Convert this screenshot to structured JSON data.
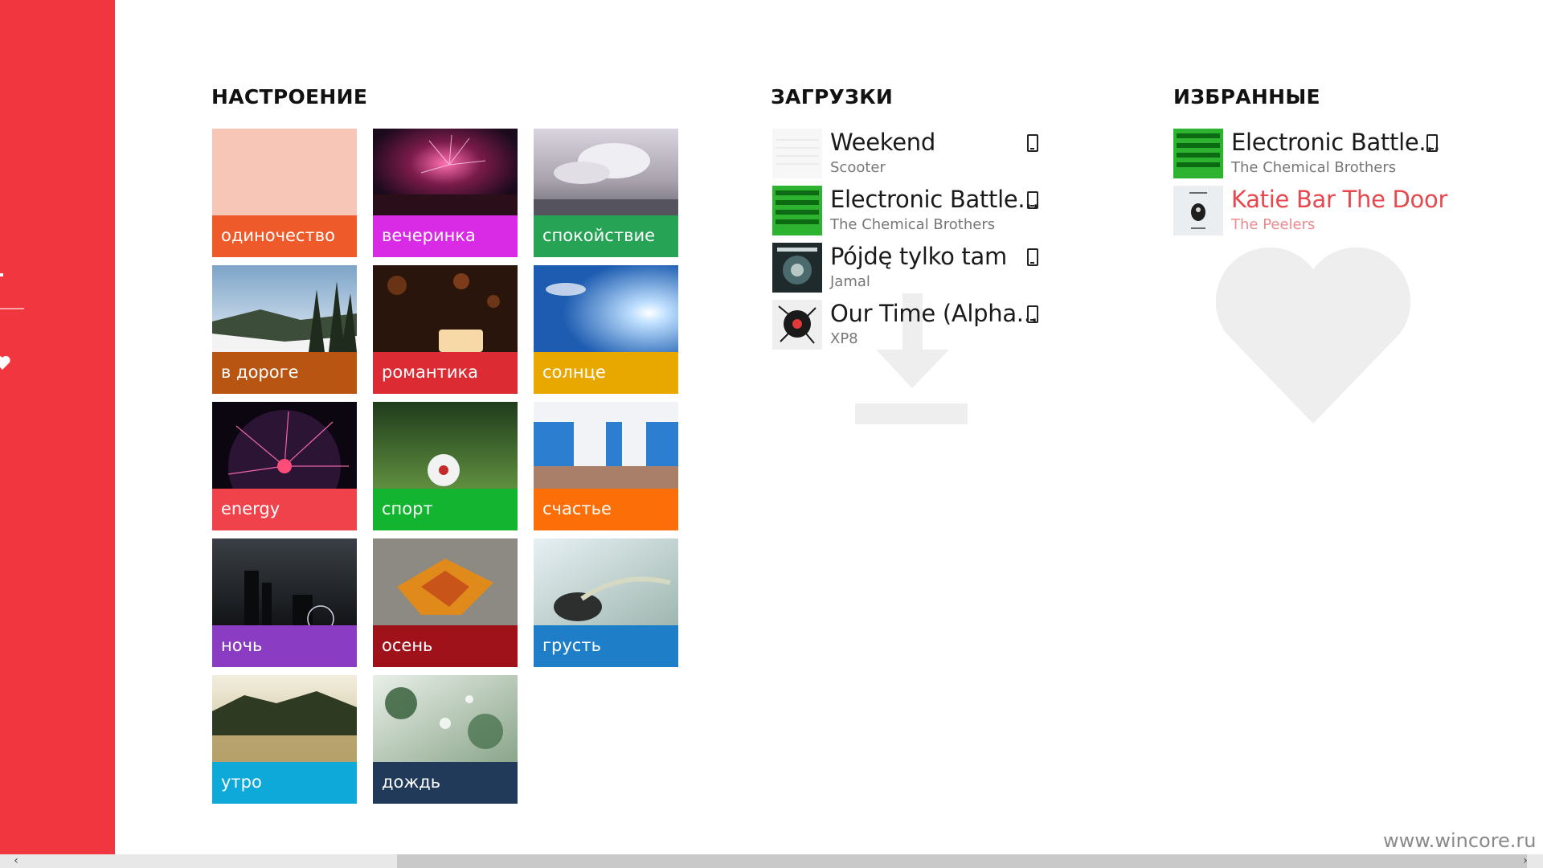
{
  "sidebar": {
    "color": "#f2363f"
  },
  "sections": {
    "mood": {
      "title": "НАСТРОЕНИЕ"
    },
    "downloads": {
      "title": "ЗАГРУЗКИ"
    },
    "favorites": {
      "title": "ИЗБРАННЫЕ"
    }
  },
  "moods": [
    {
      "label": "одиночество",
      "band": "#ef5a2a"
    },
    {
      "label": "вечеринка",
      "band": "#d92be6"
    },
    {
      "label": "спокойствие",
      "band": "#26a355"
    },
    {
      "label": "в дороге",
      "band": "#b85513"
    },
    {
      "label": "романтика",
      "band": "#dc2b32"
    },
    {
      "label": "солнце",
      "band": "#e9a800"
    },
    {
      "label": "energy",
      "band": "#f0424b"
    },
    {
      "label": "спорт",
      "band": "#13b42f"
    },
    {
      "label": "счастье",
      "band": "#fb6e08"
    },
    {
      "label": "ночь",
      "band": "#8a3dc2"
    },
    {
      "label": "осень",
      "band": "#a0121a"
    },
    {
      "label": "грусть",
      "band": "#1f7ec8"
    },
    {
      "label": "утро",
      "band": "#0ea9d8"
    },
    {
      "label": "дождь",
      "band": "#213a59"
    }
  ],
  "downloads": [
    {
      "title": "Weekend",
      "artist": "Scooter",
      "icon": "device-icon"
    },
    {
      "title": "Electronic Battle...",
      "artist": "The Chemical Brothers",
      "icon": "device-icon"
    },
    {
      "title": "Pójdę tylko tam",
      "artist": "Jamal",
      "icon": "device-icon"
    },
    {
      "title": "Our Time (Alpha...",
      "artist": "XP8",
      "icon": "device-icon"
    }
  ],
  "favorites": [
    {
      "title": "Electronic Battle...",
      "artist": "The Chemical Brothers",
      "icon": "device-icon"
    },
    {
      "title": "Katie Bar The Door",
      "artist": "The Peelers",
      "accent": "#e8474e"
    }
  ],
  "watermark": "www.wincore.ru",
  "scroll": {
    "left_arrow": "‹",
    "right_arrow": "›"
  }
}
